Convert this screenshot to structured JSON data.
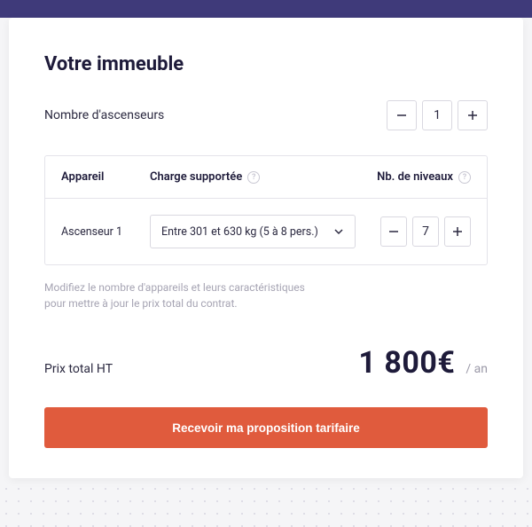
{
  "title": "Votre immeuble",
  "elevator_count": {
    "label": "Nombre d'ascenseurs",
    "value": "1"
  },
  "table": {
    "headers": {
      "appareil": "Appareil",
      "charge": "Charge supportée",
      "niveaux": "Nb. de niveaux"
    },
    "rows": [
      {
        "name": "Ascenseur 1",
        "charge_selected": "Entre 301 et 630 kg (5 à 8 pers.)",
        "levels": "7"
      }
    ]
  },
  "hint_line1": "Modifiez le nombre d'appareils et leurs caractéristiques",
  "hint_line2": "pour mettre à jour le prix total du contrat.",
  "price": {
    "label": "Prix total HT",
    "value": "1 800€",
    "period": "/ an"
  },
  "cta_label": "Recevoir ma proposition tarifaire"
}
